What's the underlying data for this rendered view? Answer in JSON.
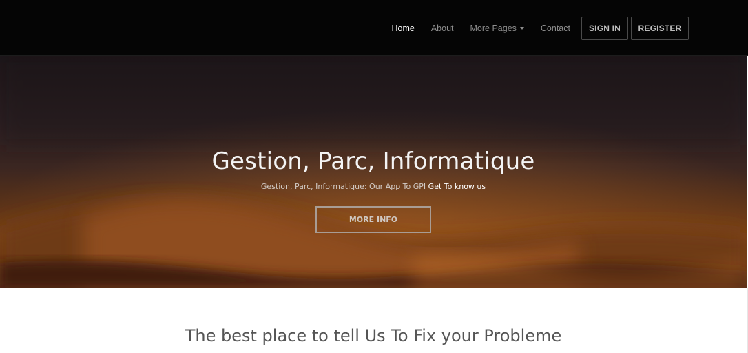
{
  "nav": {
    "links": [
      {
        "label": "Home",
        "active": true
      },
      {
        "label": "About",
        "active": false
      },
      {
        "label": "More Pages",
        "active": false,
        "dropdown": true
      },
      {
        "label": "Contact",
        "active": false
      }
    ],
    "signin_label": "SIGN IN",
    "register_label": "REGISTER"
  },
  "hero": {
    "title": "Gestion, Parc, Informatique",
    "subtitle": "Gestion, Parc, Informatique: Our App To GPI",
    "subtitle_link": "Get To know us",
    "button_label": "MORE INFO"
  },
  "section": {
    "title": "The best place to tell Us To Fix your Probleme"
  },
  "colors": {
    "navbar_bg": "#050505",
    "hero_top": "#1c1519",
    "hero_glow": "#a85a1e",
    "text_light": "#f4f4f4",
    "section_text": "#555555"
  }
}
